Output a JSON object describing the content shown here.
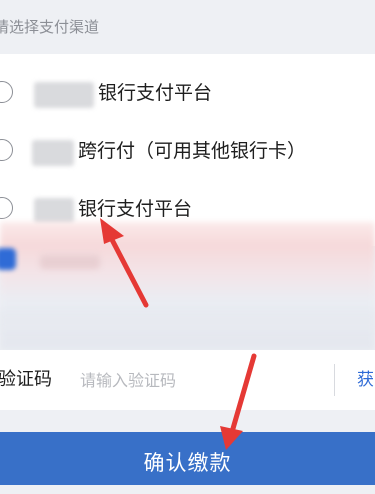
{
  "section_title": "请选择支付渠道",
  "payment_options": [
    {
      "label": "银行支付平台",
      "selected": false
    },
    {
      "label": "跨行付（可用其他银行卡）",
      "selected": false
    },
    {
      "label": "银行支付平台",
      "selected": false
    }
  ],
  "verification": {
    "label": "验证码",
    "placeholder": "请输入验证码",
    "get_code_label": "获"
  },
  "confirm_button": "确认缴款",
  "colors": {
    "accent": "#3870c8",
    "link": "#2f6bd6",
    "annotation_arrow": "#e53935"
  }
}
